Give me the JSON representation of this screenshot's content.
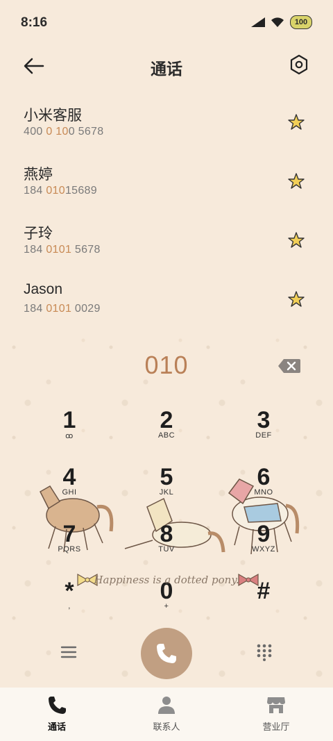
{
  "status": {
    "time": "8:16",
    "battery": "100"
  },
  "header": {
    "title": "通话"
  },
  "contacts": [
    {
      "name": "小米客服",
      "num_pre": "400 ",
      "num_hl": "0 10",
      "num_post": "0 5678"
    },
    {
      "name": "燕婷",
      "num_pre": "184 ",
      "num_hl": "010",
      "num_post": "15689"
    },
    {
      "name": "子玲",
      "num_pre": "184 ",
      "num_hl": "0101",
      "num_post": " 5678"
    },
    {
      "name": "Jason",
      "num_pre": "184 ",
      "num_hl": "0101",
      "num_post": " 0029"
    }
  ],
  "dialer": {
    "entered": "010"
  },
  "keys": [
    {
      "d": "1",
      "l": "ꝏ"
    },
    {
      "d": "2",
      "l": "ABC"
    },
    {
      "d": "3",
      "l": "DEF"
    },
    {
      "d": "4",
      "l": "GHI"
    },
    {
      "d": "5",
      "l": "JKL"
    },
    {
      "d": "6",
      "l": "MNO"
    },
    {
      "d": "7",
      "l": "PQRS"
    },
    {
      "d": "8",
      "l": "TUV"
    },
    {
      "d": "9",
      "l": "WXYZ"
    },
    {
      "d": "*",
      "l": ","
    },
    {
      "d": "0",
      "l": "+"
    },
    {
      "d": "#",
      "l": ""
    }
  ],
  "slogan": "Happiness is a dotted pony.",
  "nav": [
    {
      "label": "通话",
      "icon": "phone-icon"
    },
    {
      "label": "联系人",
      "icon": "person-icon"
    },
    {
      "label": "营业厅",
      "icon": "store-icon"
    }
  ],
  "colors": {
    "accent": "#c19f82",
    "highlight": "#c88a55",
    "background": "#f7eadb"
  }
}
